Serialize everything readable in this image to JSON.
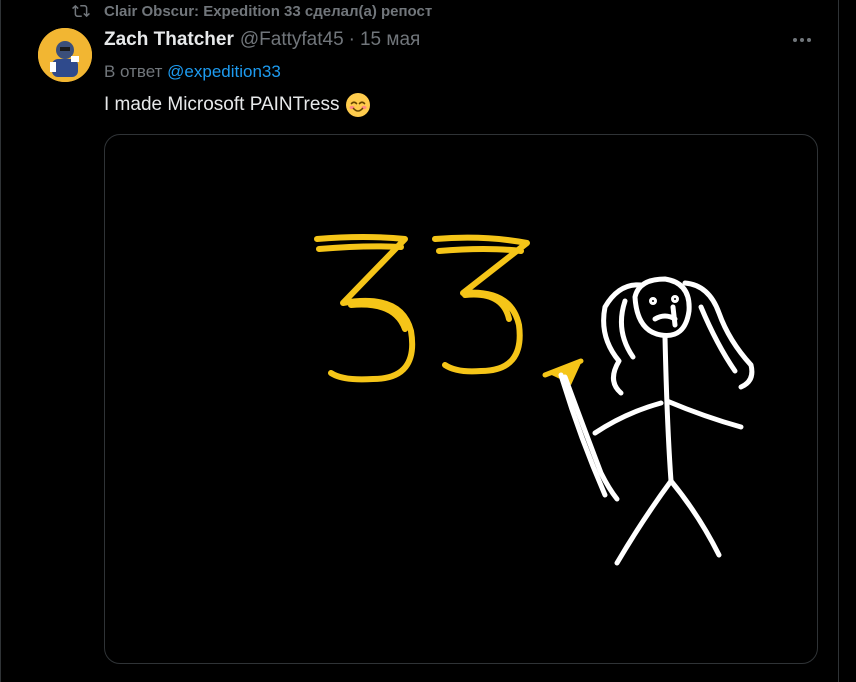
{
  "repost": {
    "text": "Clair Obscur: Expedition 33 сделал(а) репост",
    "icon": "repost-icon"
  },
  "post": {
    "author_name": "Zach Thatcher",
    "author_handle": "@Fattyfat45",
    "separator": "·",
    "date": "15 мая",
    "reply_prefix": "В ответ",
    "reply_to": "@expedition33",
    "text": "I made Microsoft PAINTress",
    "emoji": "smiling-face-icon",
    "media_drawn_text": "33"
  },
  "colors": {
    "background": "#000000",
    "text_primary": "#e7e9ea",
    "text_secondary": "#71767b",
    "link": "#1d9bf0",
    "drawing_yellow": "#f5c518",
    "drawing_white": "#ffffff"
  }
}
